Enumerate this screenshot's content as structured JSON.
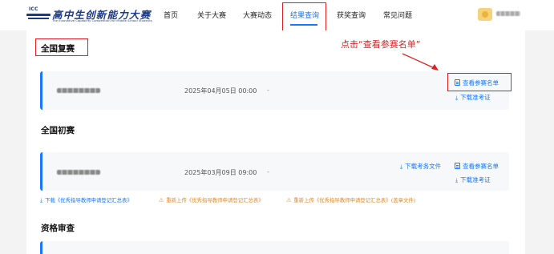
{
  "header": {
    "logo": {
      "mark_text": "ICC",
      "title": "高中生创新能力大赛",
      "subtitle": "The Innovative Capability Competition for Middle School Students"
    },
    "nav": [
      {
        "label": "首页"
      },
      {
        "label": "关于大赛"
      },
      {
        "label": "大赛动态"
      },
      {
        "label": "结果查询",
        "active": true
      },
      {
        "label": "获奖查询"
      },
      {
        "label": "常见问题"
      }
    ],
    "user": {
      "avatar_icon": "user-avatar-icon"
    }
  },
  "annotation": {
    "text": "点击“查看参赛名单”",
    "color": "#e02020"
  },
  "sections": {
    "national_final": {
      "title": "全国复赛",
      "card": {
        "date": "2025年04月05日 00:00",
        "dash": "-",
        "view_list": "查看参赛名单",
        "download_admit": "下载准考证"
      }
    },
    "national_prelim": {
      "title": "全国初赛",
      "card": {
        "date": "2025年03月09日 09:00",
        "dash": "-",
        "download_exam": "下载考务文件",
        "view_list": "查看参赛名单",
        "download_admit": "下载准考证"
      },
      "actions": {
        "download_summary": "下载《优秀指导教师申请登记汇总表》",
        "reupload_summary": "重新上传《优秀指导教师申请登记汇总表》",
        "reupload_sealed": "重新上传《优秀指导教师申请登记汇总表》(盖章文件)"
      }
    },
    "qualification": {
      "title": "资格审查"
    }
  },
  "colors": {
    "accent": "#1677ff",
    "highlight": "#e02020",
    "warning": "#e8892b",
    "brand": "#1b3a8c"
  }
}
